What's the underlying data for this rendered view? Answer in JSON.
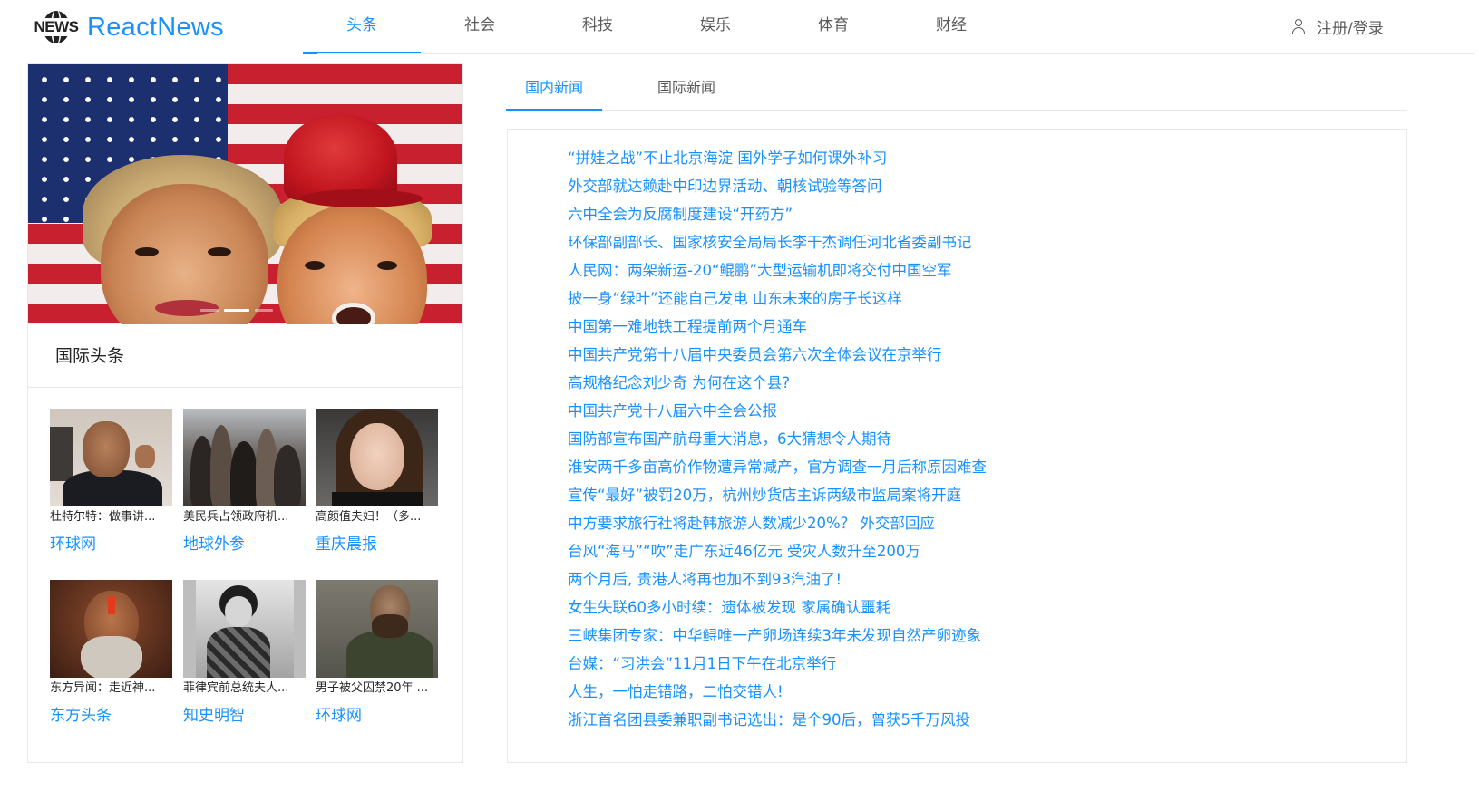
{
  "header": {
    "logo_mark_text": "NEWS",
    "logo_text": "ReactNews",
    "nav": [
      {
        "label": "头条",
        "active": true
      },
      {
        "label": "社会",
        "active": false
      },
      {
        "label": "科技",
        "active": false
      },
      {
        "label": "娱乐",
        "active": false
      },
      {
        "label": "体育",
        "active": false
      },
      {
        "label": "财经",
        "active": false
      }
    ],
    "login_label": "注册/登录",
    "login_icon": "user-icon"
  },
  "colors": {
    "accent": "#1890ff",
    "border": "#e8e8e8",
    "text": "#595959"
  },
  "carousel": {
    "slide_count": 3,
    "active_slide": 2
  },
  "intl_headlines": {
    "title": "国际头条",
    "items": [
      {
        "caption": "杜特尔特：做事讲...",
        "source": "环球网"
      },
      {
        "caption": "美民兵占领政府机...",
        "source": "地球外参"
      },
      {
        "caption": "高颜值夫妇！（多...",
        "source": "重庆晨报"
      },
      {
        "caption": "东方异闻：走近神...",
        "source": "东方头条"
      },
      {
        "caption": "菲律宾前总统夫人...",
        "source": "知史明智"
      },
      {
        "caption": "男子被父囚禁20年 ...",
        "source": "环球网"
      }
    ]
  },
  "news_tabs": [
    {
      "label": "国内新闻",
      "active": true
    },
    {
      "label": "国际新闻",
      "active": false
    }
  ],
  "news_list": [
    "“拼娃之战”不止北京海淀 国外学子如何课外补习",
    "外交部就达赖赴中印边界活动、朝核试验等答问",
    "六中全会为反腐制度建设“开药方”",
    "环保部副部长、国家核安全局局长李干杰调任河北省委副书记",
    "人民网：两架新运-20“鲲鹏”大型运输机即将交付中国空军",
    "披一身“绿叶”还能自己发电 山东未来的房子长这样",
    "中国第一难地铁工程提前两个月通车",
    "中国共产党第十八届中央委员会第六次全体会议在京举行",
    "高规格纪念刘少奇 为何在这个县?",
    "中国共产党十八届六中全会公报",
    "国防部宣布国产航母重大消息，6大猜想令人期待",
    "淮安两千多亩高价作物遭异常减产，官方调查一月后称原因难查",
    "宣传“最好”被罚20万，杭州炒货店主诉两级市监局案将开庭",
    "中方要求旅行社将赴韩旅游人数减少20%？ 外交部回应",
    "台风“海马”“吹”走广东近46亿元 受灾人数升至200万",
    "两个月后, 贵港人将再也加不到93汽油了!",
    "女生失联60多小时续：遗体被发现 家属确认噩耗",
    "三峡集团专家：中华鲟唯一产卵场连续3年未发现自然产卵迹象",
    "台媒：“习洪会”11月1日下午在北京举行",
    "人生，一怕走错路，二怕交错人!",
    "浙江首名团县委兼职副书记选出：是个90后，曾获5千万风投"
  ]
}
